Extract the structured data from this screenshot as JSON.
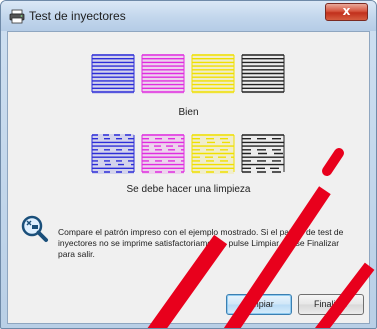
{
  "window": {
    "title": "Test de inyectores",
    "close_glyph": "x"
  },
  "patterns": {
    "good_label": "Bien",
    "bad_label": "Se debe hacer una limpieza",
    "colors": [
      "#2d2dd8",
      "#e02de0",
      "#f0e000",
      "#222222"
    ]
  },
  "message": {
    "text": "Compare el patrón impreso con el ejemplo mostrado. Si el patrón de test de inyectores no se imprime satisfactoriamente, pulse Limpiar. Pulse Finalizar para salir."
  },
  "buttons": {
    "clean_label": "Limpiar",
    "finish_label": "Finalizar"
  },
  "watermark": {
    "color": "#e8001c"
  }
}
